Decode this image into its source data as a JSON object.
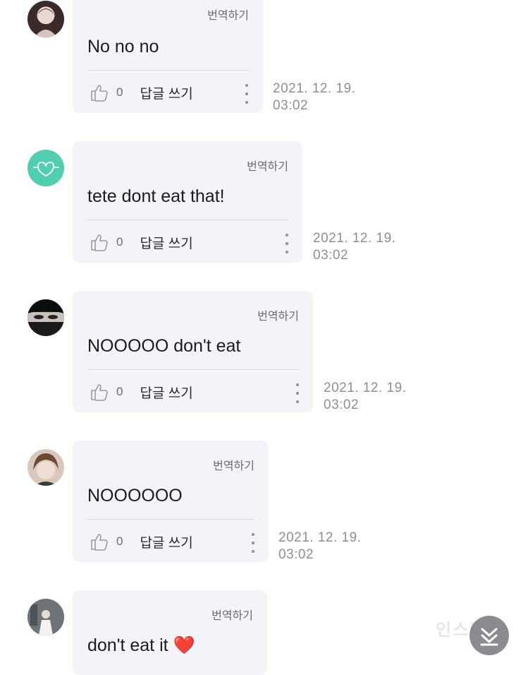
{
  "comments": [
    {
      "translate": "번역하기",
      "text": "No no no",
      "likes": "0",
      "reply": "답글 쓰기",
      "date": "2021. 12. 19.",
      "time": "03:02",
      "avatar_icon": "user-avatar-photo"
    },
    {
      "translate": "번역하기",
      "text": "tete dont eat that!",
      "likes": "0",
      "reply": "답글 쓰기",
      "date": "2021. 12. 19.",
      "time": "03:02",
      "avatar_icon": "heart-logo-avatar"
    },
    {
      "translate": "번역하기",
      "text": "NOOOOO don't eat",
      "likes": "0",
      "reply": "답글 쓰기",
      "date": "2021. 12. 19.",
      "time": "03:02",
      "avatar_icon": "user-avatar-photo"
    },
    {
      "translate": "번역하기",
      "text": "NOOOOOO",
      "likes": "0",
      "reply": "답글 쓰기",
      "date": "2021. 12. 19.",
      "time": "03:02",
      "avatar_icon": "user-avatar-photo"
    },
    {
      "translate": "번역하기",
      "text": "don't eat it",
      "emoji": "❤️",
      "avatar_icon": "user-avatar-photo"
    }
  ],
  "watermark": "인스티즈",
  "colors": {
    "bubble": "#f3f4f8",
    "text": "#1c1c1e",
    "muted": "#8e8e93",
    "teal_avatar": "#4fcfb0"
  },
  "icons": {
    "like": "thumbs-up-icon",
    "more": "more-vertical-icon",
    "scroll": "scroll-to-bottom-icon"
  }
}
